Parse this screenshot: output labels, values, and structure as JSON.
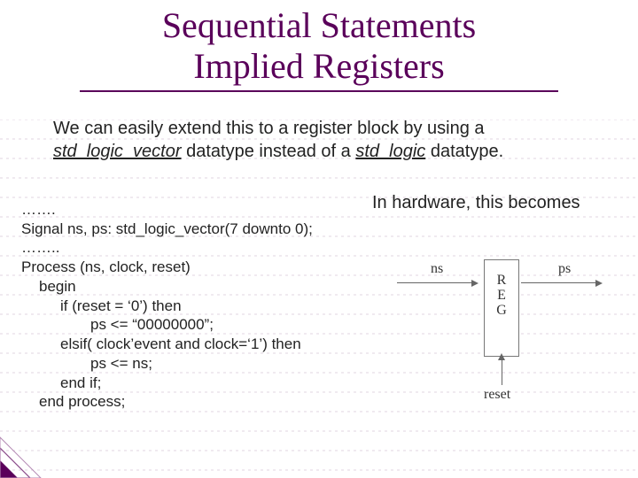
{
  "title": {
    "line1": "Sequential Statements",
    "line2": "Implied Registers"
  },
  "intro": {
    "pre": "We can easily extend this to a register block by using a ",
    "type1": "std_logic_vector",
    "mid": " datatype instead of a ",
    "type2": "std_logic",
    "post": " datatype."
  },
  "hardware_note": "In hardware, this becomes",
  "code": {
    "l0": "…….",
    "l1": "Signal ns, ps: std_logic_vector(7 downto 0);",
    "l2": "……..",
    "l3": "Process (ns, clock, reset)",
    "l4": "begin",
    "l5": "if (reset = ‘0’) then",
    "l6": "ps <= “00000000”;",
    "l7": "elsif( clock’event and clock=‘1’) then",
    "l8": "ps <= ns;",
    "l9": "end if;",
    "l10": "end process;"
  },
  "diagram": {
    "ns": "ns",
    "ps": "ps",
    "reg_r": "R",
    "reg_e": "E",
    "reg_g": "G",
    "reset": "reset"
  },
  "colors": {
    "accent": "#5a005a",
    "grid": "#d8d0d8"
  }
}
